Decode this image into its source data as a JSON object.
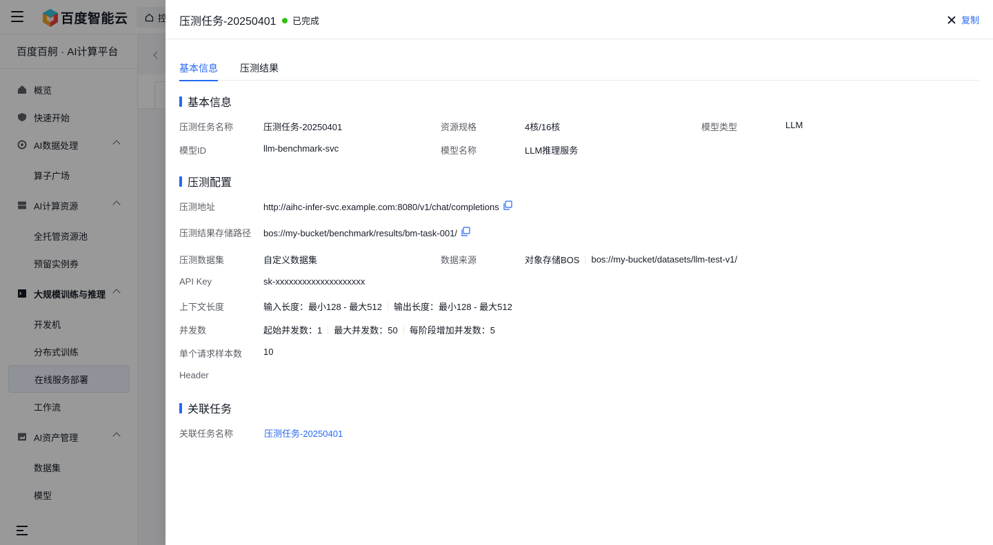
{
  "app": {
    "brand": "百度智能云",
    "top_tab": "控",
    "platform_title": "百度百舸 · AI计算平台"
  },
  "sidebar": {
    "items": [
      {
        "label": "概览"
      },
      {
        "label": "快速开始"
      },
      {
        "label": "AI数据处理"
      },
      {
        "label": "算子广场"
      },
      {
        "label": "AI计算资源"
      },
      {
        "label": "全托管资源池"
      },
      {
        "label": "预留实例券"
      },
      {
        "label": "大规模训练与推理"
      },
      {
        "label": "开发机"
      },
      {
        "label": "分布式训练"
      },
      {
        "label": "在线服务部署"
      },
      {
        "label": "工作流"
      },
      {
        "label": "AI资产管理"
      },
      {
        "label": "数据集"
      },
      {
        "label": "模型"
      }
    ]
  },
  "drawer": {
    "title": "压测任务-20250401",
    "status": "已完成",
    "status_color": "#30bf13",
    "copy_label": "复制",
    "tabs": [
      {
        "label": "基本信息",
        "active": true
      },
      {
        "label": "压测结果",
        "active": false
      }
    ],
    "basic": {
      "section_title": "基本信息",
      "task_name_label": "压测任务名称",
      "task_name": "压测任务-20250401",
      "resource_label": "资源规格",
      "resource": "4核/16核",
      "model_type_label": "模型类型",
      "model_type": "LLM",
      "model_id_label": "模型ID",
      "model_id": "llm-benchmark-svc",
      "model_name_label": "模型名称",
      "model_name": "LLM推理服务"
    },
    "config": {
      "section_title": "压测配置",
      "address_label": "压测地址",
      "address": "http://aihc-infer-svc.example.com:8080/v1/chat/completions",
      "result_path_label": "压测结果存储路径",
      "result_path": "bos://my-bucket/benchmark/results/bm-task-001/",
      "dataset_label": "压测数据集",
      "dataset": "自定义数据集",
      "source_label": "数据来源",
      "source_type": "对象存储BOS",
      "source_path": "bos://my-bucket/datasets/llm-test-v1/",
      "api_key_label": "API Key",
      "api_key": "sk-xxxxxxxxxxxxxxxxxxxx",
      "context_label": "上下文长度",
      "input_length": "输入长度：最小128 - 最大512",
      "output_length": "输出长度：最小128 - 最大512",
      "concurrency_label": "并发数",
      "start_concurrency": "起始并发数：1",
      "max_concurrency": "最大并发数：50",
      "step_concurrency": "每阶段增加并发数：5",
      "samples_label": "单个请求样本数",
      "samples": "10",
      "header_label": "Header"
    },
    "related": {
      "section_title": "关联任务",
      "task_label": "关联任务名称",
      "task_link": "压测任务-20250401"
    }
  },
  "colors": {
    "accent": "#2468f2",
    "text": "#151b26",
    "label": "#5c5f66"
  }
}
